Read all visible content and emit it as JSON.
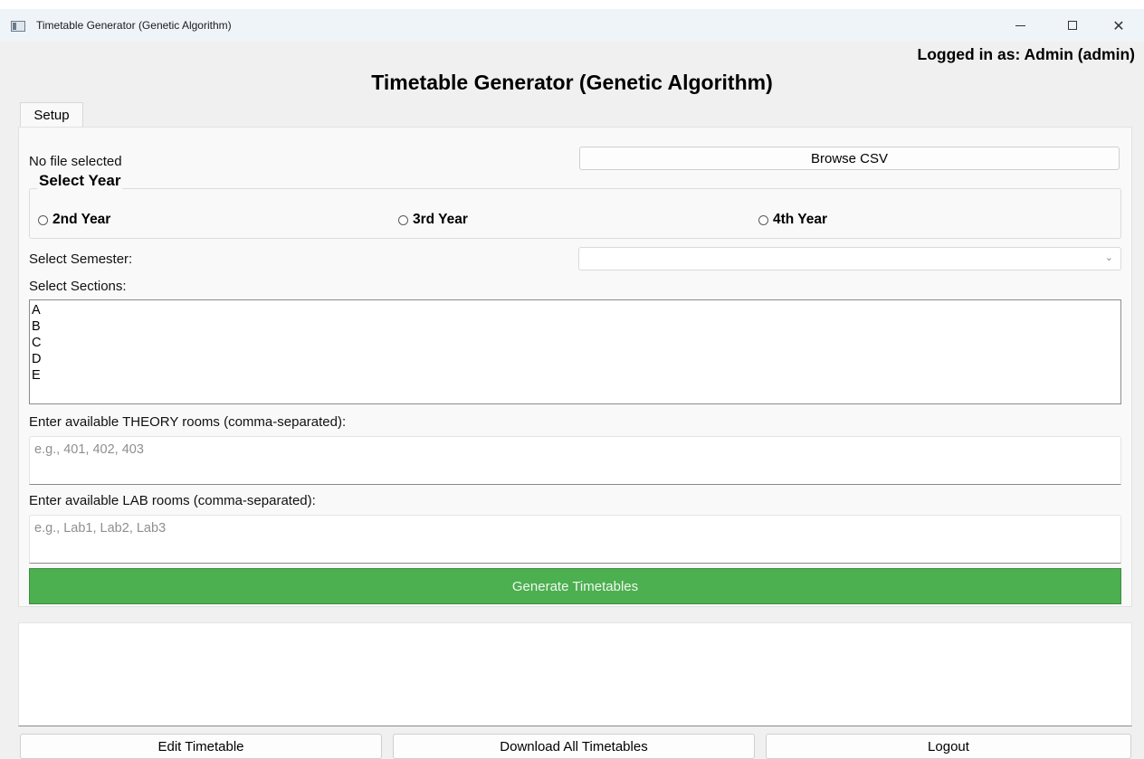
{
  "window": {
    "title": "Timetable Generator (Genetic Algorithm)",
    "minimize_glyph": "—",
    "close_glyph": "✕"
  },
  "header": {
    "logged_in": "Logged in as: Admin (admin)",
    "title": "Timetable Generator (Genetic Algorithm)"
  },
  "tabs": [
    {
      "label": "Setup"
    }
  ],
  "setup": {
    "file_status": "No file selected",
    "browse_label": "Browse CSV",
    "year_group_title": "Select Year",
    "years": [
      {
        "label": "2nd Year"
      },
      {
        "label": "3rd Year"
      },
      {
        "label": "4th Year"
      }
    ],
    "semester_label": "Select Semester:",
    "semester_value": "",
    "combo_arrow": "⌄",
    "sections_label": "Select Sections:",
    "sections": [
      "A",
      "B",
      "C",
      "D",
      "E"
    ],
    "theory_label": "Enter available THEORY rooms (comma-separated):",
    "theory_placeholder": "e.g., 401, 402, 403",
    "lab_label": "Enter available LAB rooms (comma-separated):",
    "lab_placeholder": "e.g., Lab1, Lab2, Lab3",
    "generate_label": "Generate Timetables"
  },
  "output": {
    "text": ""
  },
  "footer": {
    "edit_label": "Edit Timetable",
    "download_label": "Download All Timetables",
    "logout_label": "Logout"
  },
  "colors": {
    "generate_bg": "#4caf50",
    "titlebar_bg": "#eff4f9"
  }
}
